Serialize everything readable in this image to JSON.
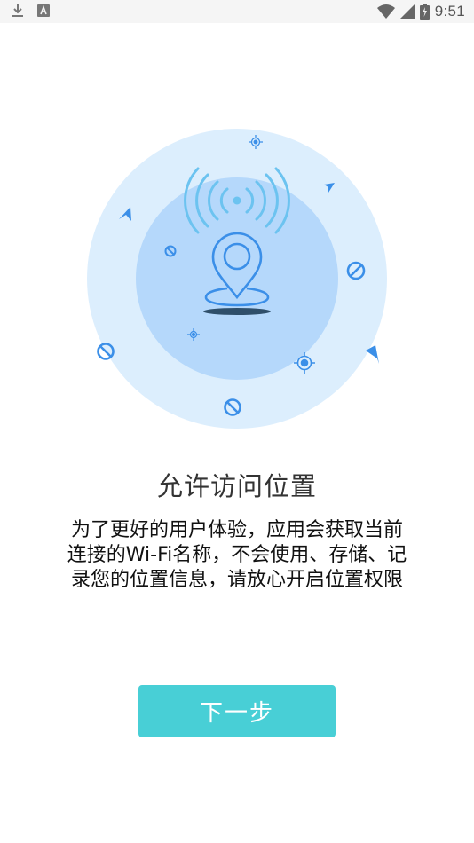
{
  "status_bar": {
    "time": "9:51",
    "left_icons": [
      "download-icon",
      "app-notification-icon"
    ],
    "right_icons": [
      "wifi-icon",
      "signal-icon",
      "battery-charging-icon"
    ]
  },
  "illustration": {
    "description_icon": "location-pin-with-signal",
    "colors": {
      "outer_circle": "#dceefd",
      "inner_circle": "#b5d8fb",
      "accent": "#3b8fe8",
      "signal": "#6cc3f0"
    }
  },
  "content": {
    "title": "允许访问位置",
    "description": "为了更好的用户体验，应用会获取当前连接的Wi-Fi名称，不会使用、存储、记录您的位置信息，请放心开启位置权限"
  },
  "actions": {
    "next_label": "下一步",
    "next_color": "#48cfd6"
  }
}
